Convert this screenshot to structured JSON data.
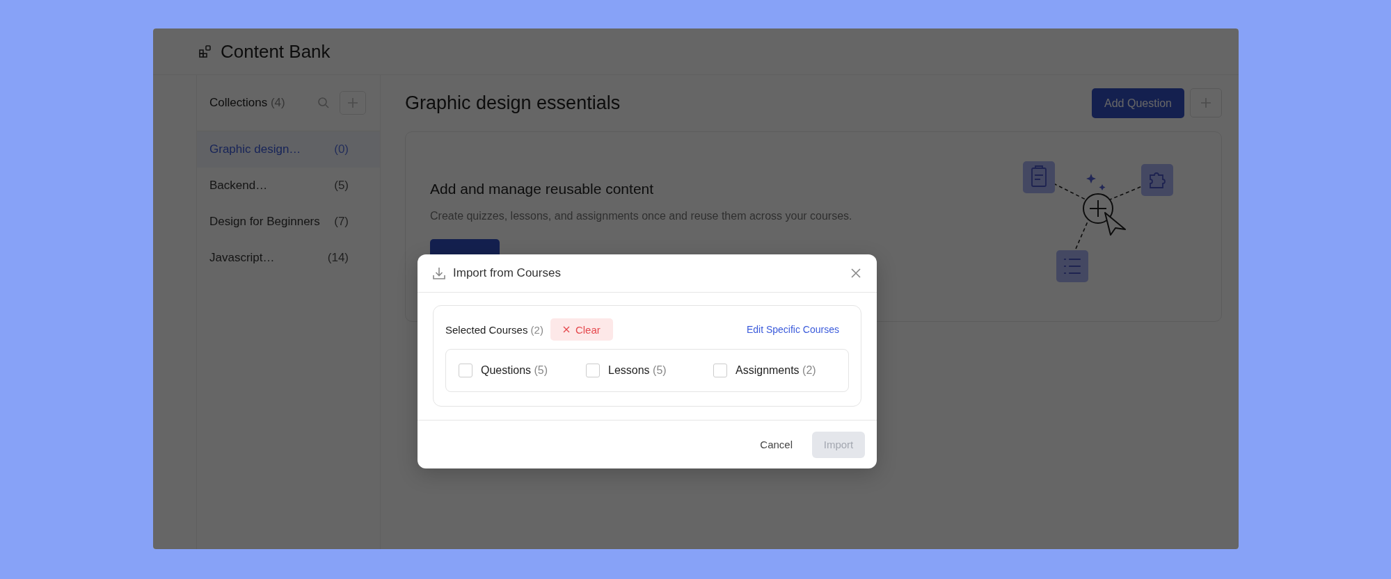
{
  "app": {
    "title": "Content Bank"
  },
  "sidebar": {
    "heading": "Collections",
    "count": "(4)",
    "items": [
      {
        "label": "Graphic design…",
        "count": "(0)",
        "selected": true
      },
      {
        "label": "Backend…",
        "count": "(5)",
        "selected": false
      },
      {
        "label": "Design for Beginners",
        "count": "(7)",
        "selected": false
      },
      {
        "label": "Javascript…",
        "count": "(14)",
        "selected": false
      }
    ]
  },
  "main": {
    "title": "Graphic design essentials",
    "primary_button": "Add Question",
    "empty_state": {
      "heading": "Add and manage reusable content",
      "description": "Create quizzes, lessons, and assignments once and reuse them across your courses."
    }
  },
  "dialog": {
    "title": "Import from Courses",
    "selected_label": "Selected Courses",
    "selected_count": "(2)",
    "clear_button": "Clear",
    "edit_link": "Edit Specific Courses",
    "options": [
      {
        "label": "Questions",
        "count": "(5)",
        "checked": false
      },
      {
        "label": "Lessons",
        "count": "(5)",
        "checked": false
      },
      {
        "label": "Assignments",
        "count": "(2)",
        "checked": false
      }
    ],
    "cancel_button": "Cancel",
    "import_button": {
      "label": "Import",
      "disabled": true
    }
  }
}
